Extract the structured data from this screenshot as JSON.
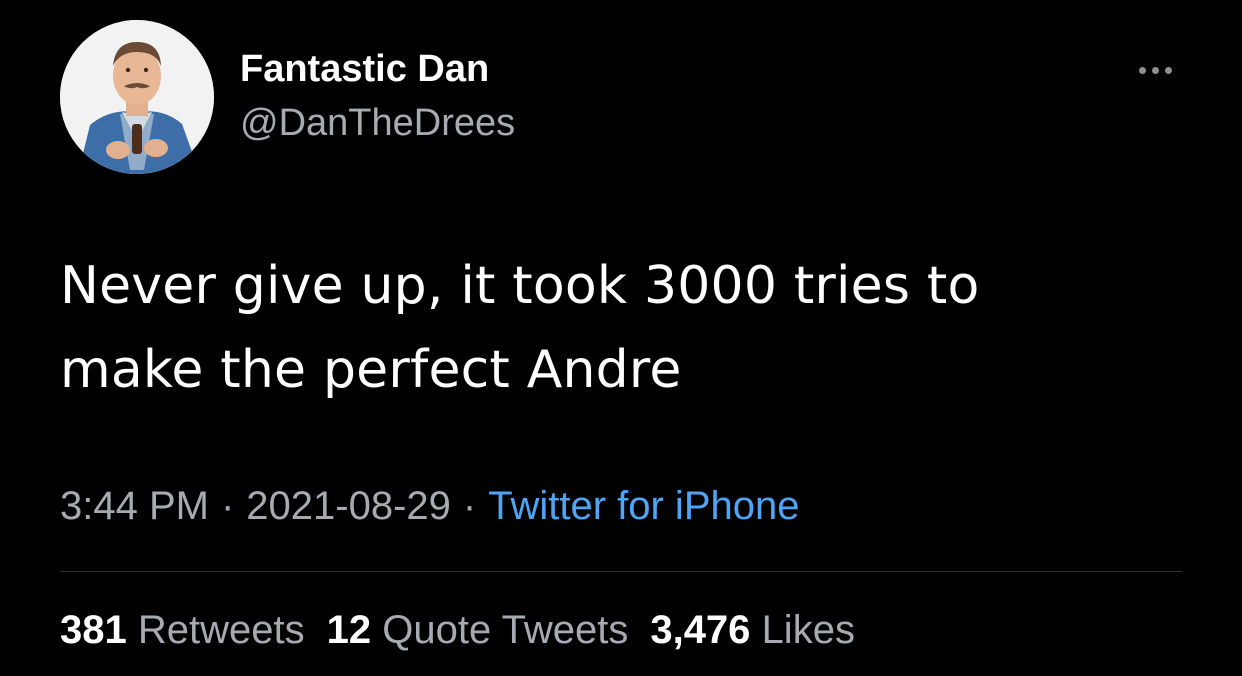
{
  "author": {
    "display_name": "Fantastic Dan",
    "handle": "@DanTheDrees",
    "avatar_icon": "profile-photo"
  },
  "menu": {
    "icon": "more-options-icon"
  },
  "tweet": {
    "text_lines": [
      "Never give up, it took 3000 tries to",
      "make the perfect Andre"
    ]
  },
  "meta": {
    "time": "3:44 PM",
    "separator": "·",
    "date": "2021-08-29",
    "source": "Twitter for iPhone"
  },
  "stats": {
    "retweets": {
      "count": "381",
      "label": "Retweets"
    },
    "quotes": {
      "count": "12",
      "label": "Quote Tweets"
    },
    "likes": {
      "count": "3,476",
      "label": "Likes"
    }
  },
  "colors": {
    "background": "#000000",
    "text_primary": "#ffffff",
    "text_secondary": "#a5abb0",
    "link": "#4ea5f5",
    "divider": "#2f3336"
  }
}
